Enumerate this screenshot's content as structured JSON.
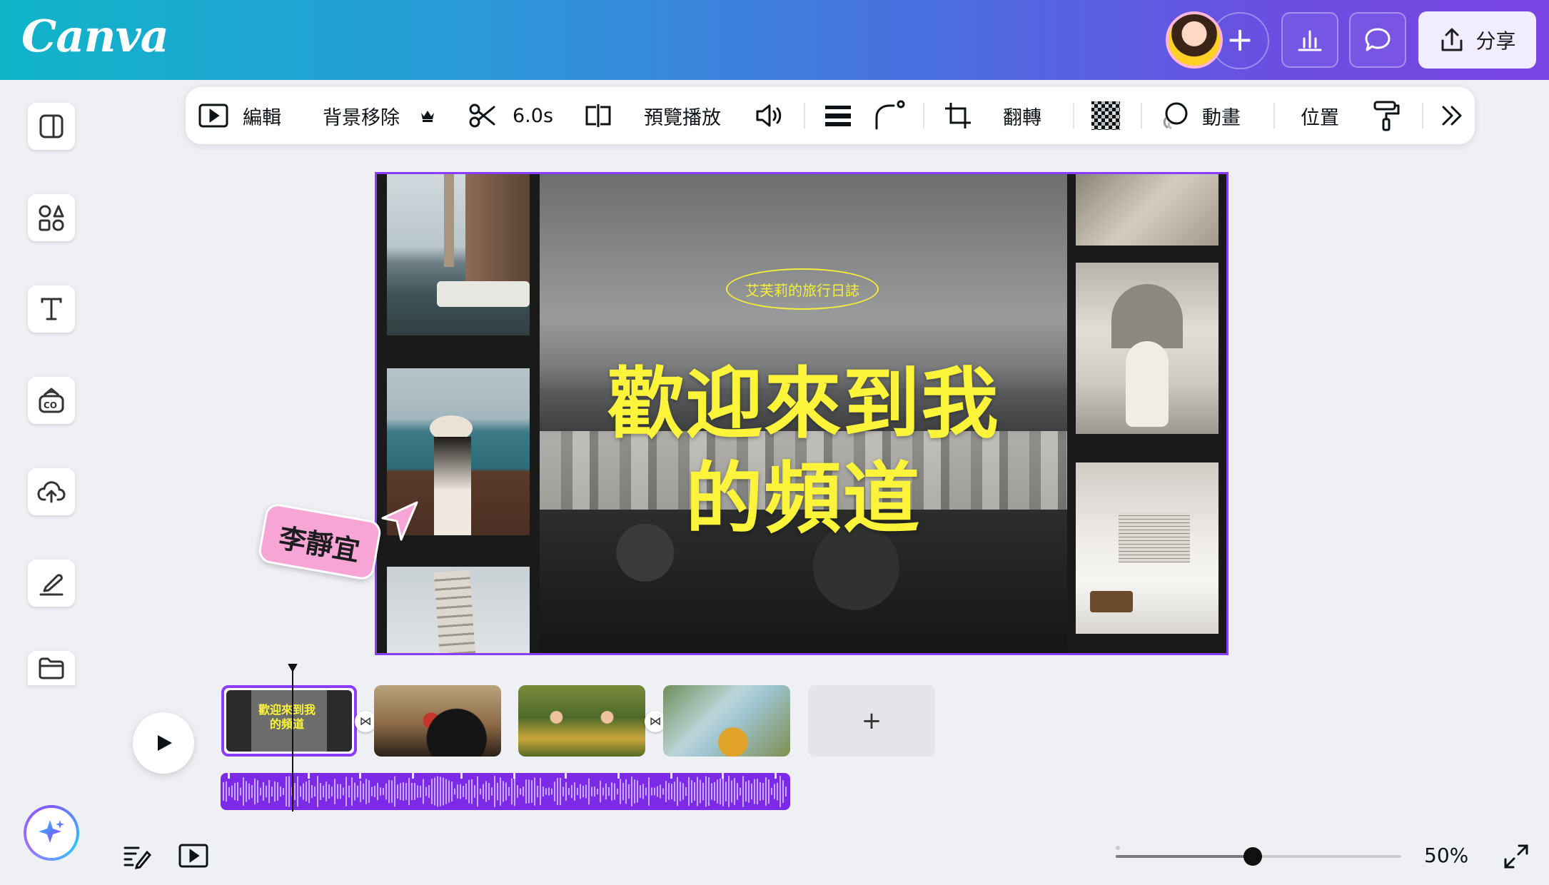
{
  "app": {
    "logo": "Canva"
  },
  "header": {
    "share_label": "分享"
  },
  "toolbar": {
    "edit_label": "編輯",
    "bg_remove_label": "背景移除",
    "duration_label": "6.0s",
    "preview_label": "預覽播放",
    "flip_label": "翻轉",
    "animate_label": "動畫",
    "position_label": "位置"
  },
  "canvas": {
    "tag_text": "艾芙莉的旅行日誌",
    "title_line1": "歡迎來到我",
    "title_line2": "的頻道"
  },
  "collaborator": {
    "name": "李靜宜"
  },
  "timeline": {
    "clip1_title_line1": "歡迎來到我",
    "clip1_title_line2": "的頻道",
    "transition_icon": "⋈",
    "add_label": "+"
  },
  "footer": {
    "zoom_label": "50%",
    "zoom_value": 0.48
  },
  "colors": {
    "accent": "#8b3dff",
    "title_yellow": "#fbf43a",
    "audio": "#7d2ae8",
    "collab_pink": "#f7a5d5"
  }
}
